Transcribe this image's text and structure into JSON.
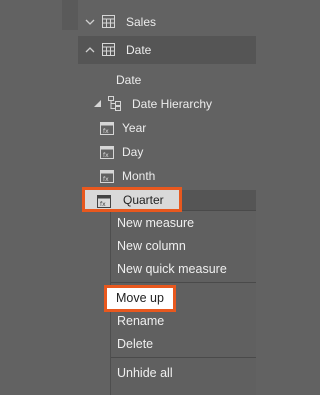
{
  "fields_pane": {
    "tables": [
      {
        "name": "Sales",
        "expanded": false,
        "icon": "table-icon"
      },
      {
        "name": "Date",
        "expanded": true,
        "icon": "table-icon"
      }
    ],
    "date_fields": {
      "date": "Date",
      "date_hierarchy": "Date Hierarchy",
      "year": "Year",
      "day": "Day",
      "month": "Month",
      "quarter": "Quarter"
    }
  },
  "context_menu": {
    "new_measure": "New measure",
    "new_column": "New column",
    "new_quick_measure": "New quick measure",
    "move_up": "Move up",
    "rename": "Rename",
    "delete": "Delete",
    "unhide_all": "Unhide all"
  },
  "colors": {
    "highlight": "#e8581e",
    "panel_overlay": "#626262"
  }
}
